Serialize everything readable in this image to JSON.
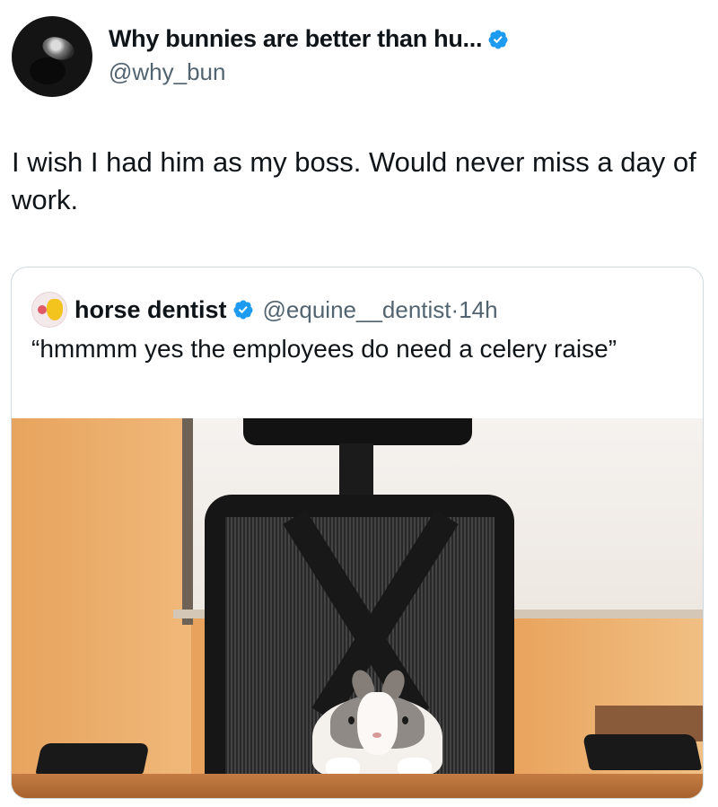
{
  "post": {
    "author": {
      "display_name": "Why bunnies are better than hu...",
      "handle": "@why_bun",
      "verified": true
    },
    "text": "I wish I had him as my boss. Would never miss a day of work."
  },
  "quote": {
    "author": {
      "display_name": "horse dentist",
      "handle": "@equine__dentist",
      "separator": "·",
      "time": "14h",
      "verified": true
    },
    "text": "“hmmmm yes the employees do need a celery raise”",
    "media": {
      "alt": "Bunny sitting at desk in black office chair"
    }
  },
  "colors": {
    "text_primary": "#0f1419",
    "text_secondary": "#536471",
    "verified_blue": "#1d9bf0",
    "card_border": "#cfd9de"
  }
}
